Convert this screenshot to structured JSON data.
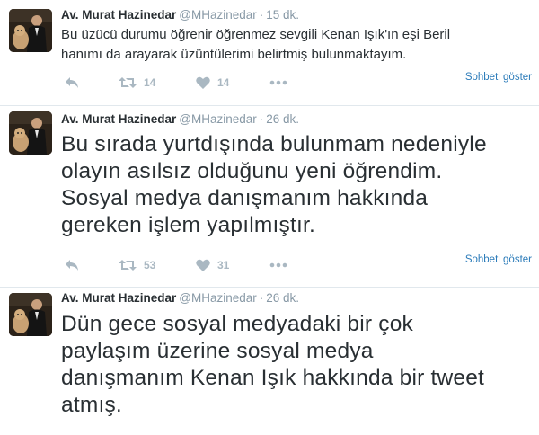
{
  "tweets": [
    {
      "fullname": "Av. Murat Hazinedar",
      "username": "@MHazinedar",
      "separator": "·",
      "time": "15 dk.",
      "lines": [
        "Bu üzücü durumu öğrenir öğrenmez sevgili Kenan Işık'ın eşi Beril",
        "hanımı da arayarak üzüntülerimi belirtmiş bulunmaktayım."
      ],
      "retweets": "14",
      "likes": "14",
      "show_conversation": "Sohbeti göster"
    },
    {
      "fullname": "Av. Murat Hazinedar",
      "username": "@MHazinedar",
      "separator": "·",
      "time": "26 dk.",
      "lines": [
        "Bu sırada yurtdışında bulunmam nedeniyle",
        "olayın asılsız olduğunu yeni öğrendim.",
        "Sosyal medya danışmanım hakkında",
        "gereken işlem yapılmıştır."
      ],
      "retweets": "53",
      "likes": "31",
      "show_conversation": "Sohbeti göster"
    },
    {
      "fullname": "Av. Murat Hazinedar",
      "username": "@MHazinedar",
      "separator": "·",
      "time": "26 dk.",
      "lines": [
        "Dün gece sosyal medyadaki bir çok",
        "paylaşım üzerine sosyal medya",
        "danışmanım Kenan Işık hakkında bir tweet",
        "atmış."
      ]
    }
  ],
  "icons": {
    "reply": "reply-icon",
    "retweet": "retweet-icon",
    "like": "heart-icon",
    "more": "more-icon"
  },
  "colors": {
    "link": "#2b7bb9",
    "muted": "#8899a6",
    "action": "#aab8c2",
    "text": "#292f33",
    "divider": "#e1e8ed"
  }
}
